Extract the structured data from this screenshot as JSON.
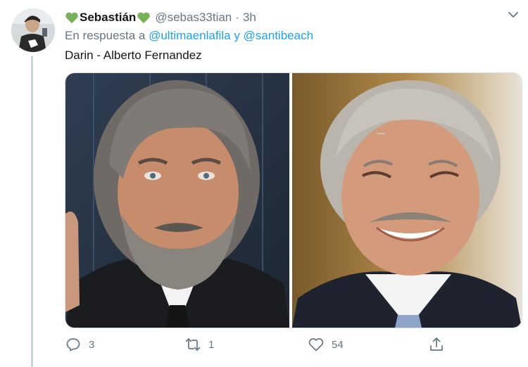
{
  "tweet": {
    "display_name": "Sebastián",
    "handle": "@sebas33tian",
    "separator": "·",
    "time": "3h",
    "reply_prefix": "En respuesta a",
    "reply_to_1": "@ultimaenlafila",
    "reply_joiner": "y",
    "reply_to_2": "@santibeach",
    "text": "Darin - Alberto Fernandez",
    "heart_color": "#78b159",
    "link_color": "#1da1f2"
  },
  "actions": {
    "reply_count": "3",
    "retweet_count": "1",
    "like_count": "54"
  },
  "icons": [
    "green-heart-icon",
    "chevron-down-icon",
    "reply-icon",
    "retweet-icon",
    "like-icon",
    "share-icon"
  ]
}
